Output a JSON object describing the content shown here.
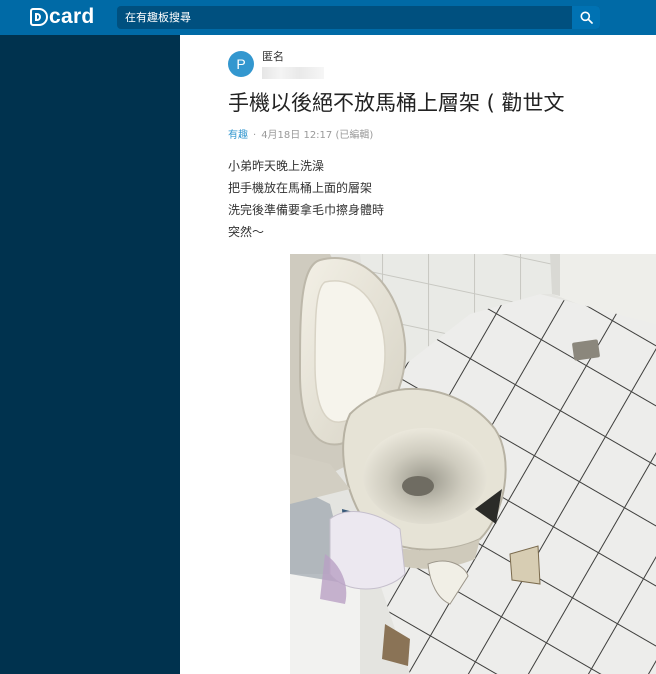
{
  "header": {
    "logo_text": "card",
    "search_placeholder": "在有趣板搜尋",
    "brand_color": "#006aa6",
    "sidebar_color": "#00324e"
  },
  "post": {
    "avatar_letter": "P",
    "author": "匿名",
    "title": "手機以後絕不放馬桶上層架 ( 勸世文",
    "forum": "有趣",
    "separator": "·",
    "timestamp": "4月18日 12:17 (已編輯)",
    "body": [
      "小弟昨天晚上洗澡",
      "把手機放在馬桶上面的層架",
      "洗完後準備要拿毛巾擦身體時",
      "突然～"
    ]
  }
}
